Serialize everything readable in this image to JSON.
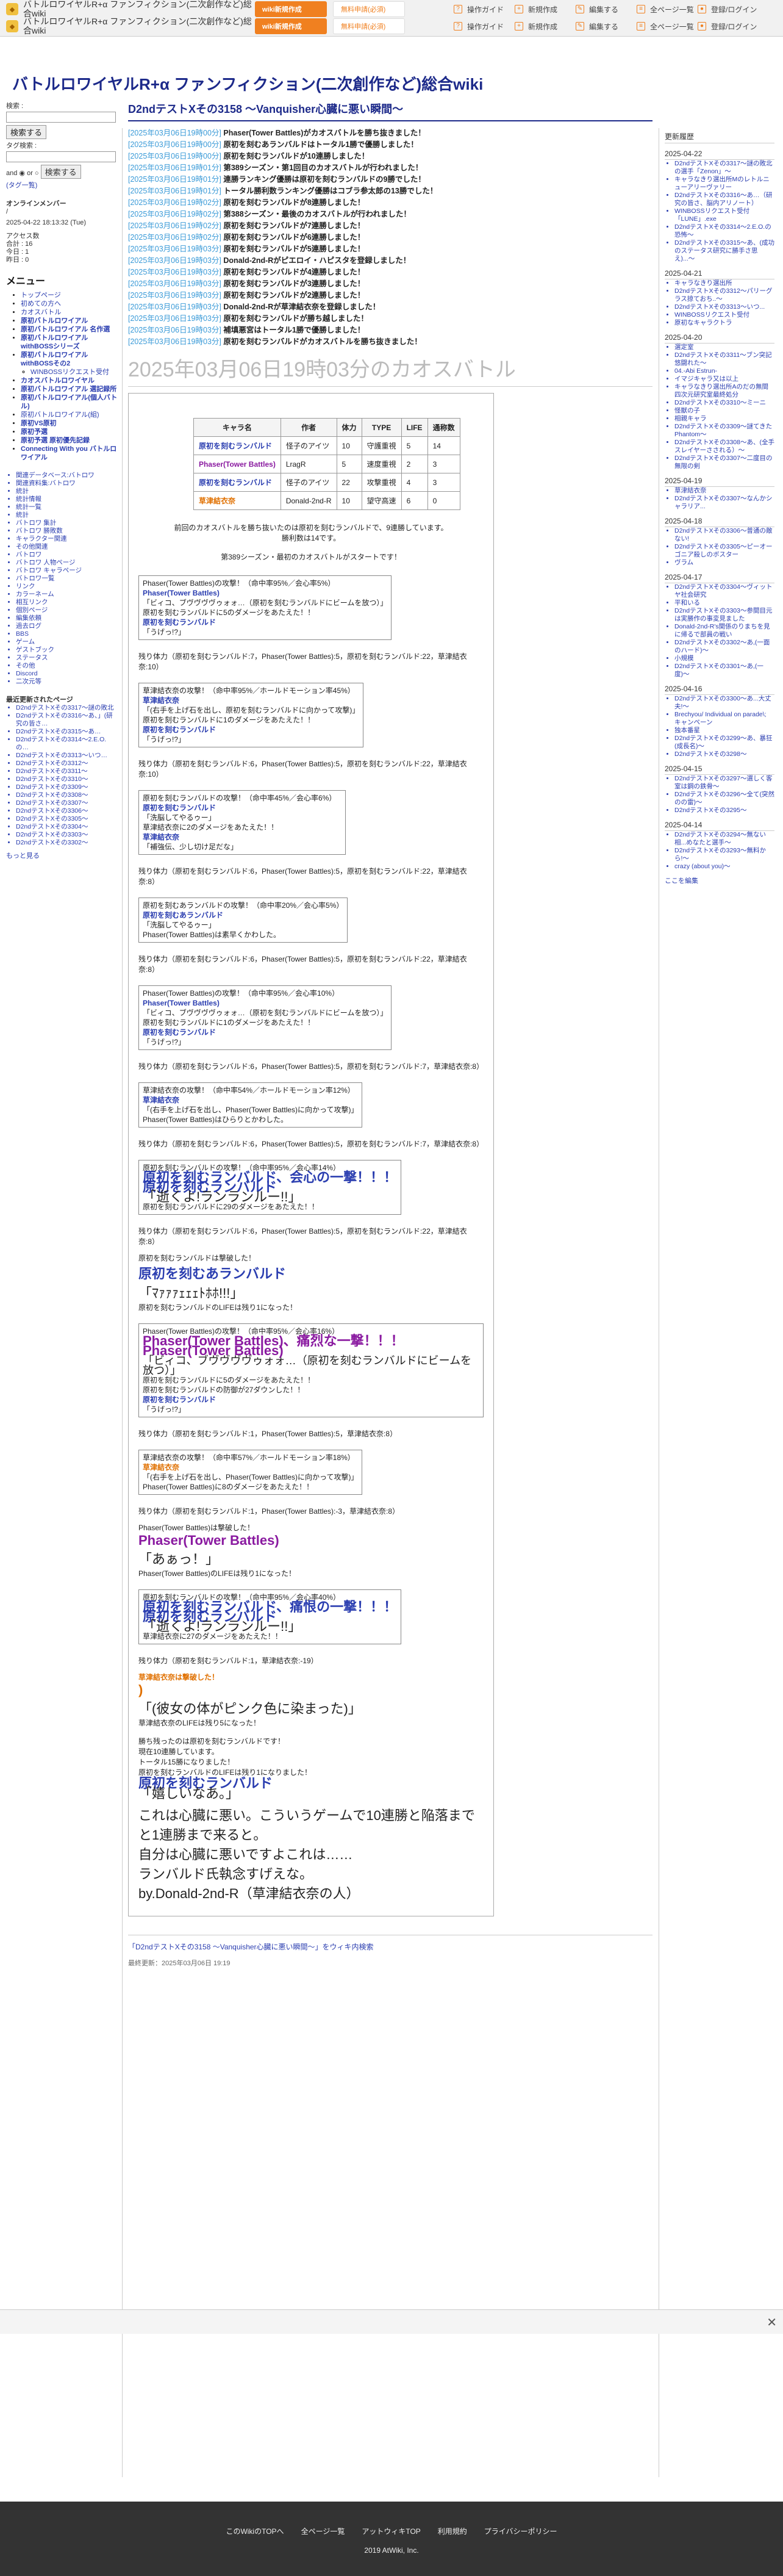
{
  "header": {
    "title_r1": "バトルロワイヤルR+α ファンフィクション(二次創作など)総合wiki",
    "title_r2": "バトルロワイヤルR+α ファンフィクション(二次創作など)総合wiki",
    "btn1": "wiki新規作成",
    "btn2": "無料申請(必須)",
    "nav": [
      "操作ガイド",
      "新規作成",
      "編集する",
      "全ページ一覧",
      "登録/ログイン"
    ]
  },
  "site_title": "バトルロワイヤルR+α ファンフィクション(二次創作など)総合wiki",
  "left": {
    "search_label1": "検索 :",
    "search_btn": "検索する",
    "tag_label": "タグ検索 :",
    "and": "and",
    "or": "or",
    "tag_btn": "検索する",
    "opt": "(タグ一覧)",
    "online_h": "オンラインメンバー",
    "online_slash": "/",
    "date": "2025-04-22 18:13:32 (Tue)",
    "access": [
      "アクセス数",
      "合計 : 16",
      "今日 : 1",
      "昨日 : 0"
    ],
    "menu_h": "メニュー",
    "menu": [
      {
        "t": "トップページ",
        "c": ""
      },
      {
        "t": "初めての方へ",
        "c": ""
      },
      {
        "t": "カオスバトル",
        "c": ""
      },
      {
        "t": "原初バトルロワイアル",
        "c": "b"
      },
      {
        "t": "原初バトルロワイアル 名作選",
        "c": "b"
      },
      {
        "t": "原初バトルロワイアル withBOSSシリーズ",
        "c": "b"
      },
      {
        "t": "原初バトルロワイアル withBOSSその2",
        "c": "b"
      },
      {
        "t": "WINBOSSリクエスト受付",
        "c": "sub"
      },
      {
        "t": "カオスバトルロワイヤル",
        "c": "b"
      },
      {
        "t": "原初バトルロワイアル 選記録所",
        "c": "b"
      },
      {
        "t": "原初バトルロワイアル(個人バトル)",
        "c": "b"
      },
      {
        "t": "原初バトルロワイアル(組)",
        "c": ""
      },
      {
        "t": "原初VS原初",
        "c": "b"
      },
      {
        "t": "原初予選",
        "c": "b"
      },
      {
        "t": "原初予選 原初優先記録",
        "c": "b"
      },
      {
        "t": "Connecting With you バトルロワイアル",
        "c": "b"
      }
    ],
    "subnav": [
      "関連データベース:バトロワ",
      "関連資料集:バトロワ",
      "統計",
      "統計情報",
      "統計一覧",
      "統計",
      "バトロワ 集計",
      "バトロワ 勝敗数",
      "キャラクター関連",
      "その他関連",
      "バトロワ",
      "バトロワ 人物ページ",
      "バトロワ キャラページ",
      "バトロワ一覧",
      "リンク",
      "カラーネーム",
      "相互リンク",
      "個別ページ",
      "編集依頼",
      "過去ログ",
      "BBS",
      "ゲーム",
      "ゲストブック",
      "ステータス",
      "その他",
      "Discord",
      "二次元等"
    ],
    "recent_h": "最近更新されたページ",
    "recent": [
      "D2ndテストXその3317〜謎の敗北",
      "D2ndテストXその3316〜あ、」(研究の皆さ…",
      "D2ndテストXその3315〜あ…",
      "D2ndテストXその3314〜2.E.O.の…",
      "D2ndテストXその3313〜いつ…",
      "D2ndテストXその3312〜",
      "D2ndテストXその3311〜",
      "D2ndテストXその3310〜",
      "D2ndテストXその3309〜",
      "D2ndテストXその3308〜",
      "D2ndテストXその3307〜",
      "D2ndテストXその3306〜",
      "D2ndテストXその3305〜",
      "D2ndテストXその3304〜",
      "D2ndテストXその3303〜",
      "D2ndテストXその3302〜"
    ],
    "more": "もっと見る"
  },
  "main": {
    "page_title": "D2ndテストXその3158 〜Vanquisher心臓に悪い瞬間〜",
    "log": [
      {
        "ts": "[2025年03月06日19時00分]",
        "t": "Phaser(Tower Battles)がカオスバトルを勝ち抜きました！"
      },
      {
        "ts": "[2025年03月06日19時00分]",
        "t": "原初を刻むあランバルドはトータル1勝で優勝しました！"
      },
      {
        "ts": "[2025年03月06日19時00分]",
        "t": "原初を刻むランバルドが10連勝しました！"
      },
      {
        "ts": "[2025年03月06日19時01分]",
        "t": "第389シーズン・第1回目のカオスバトルが行われました！"
      },
      {
        "ts": "[2025年03月06日19時01分]",
        "t": "連勝ランキング優勝は原初を刻むランバルドの9勝でした！"
      },
      {
        "ts": "[2025年03月06日19時01分]",
        "t": "トータル勝利数ランキング優勝はコブラ参太郎の13勝でした！"
      },
      {
        "ts": "[2025年03月06日19時02分]",
        "t": "原初を刻むランバルドが8連勝しました！"
      },
      {
        "ts": "[2025年03月06日19時02分]",
        "t": "第388シーズン・最後のカオスバトルが行われました！"
      },
      {
        "ts": "[2025年03月06日19時02分]",
        "t": "原初を刻むランバルドが7連勝しました！"
      },
      {
        "ts": "[2025年03月06日19時02分]",
        "t": "原初を刻むランバルドが6連勝しました！"
      },
      {
        "ts": "[2025年03月06日19時03分]",
        "t": "原初を刻むランバルドが5連勝しました！"
      },
      {
        "ts": "[2025年03月06日19時03分]",
        "t": "Donald-2nd-Rがピエロイ・ハピスタを登録しました！"
      },
      {
        "ts": "[2025年03月06日19時03分]",
        "t": "原初を刻むランバルドが4連勝しました！"
      },
      {
        "ts": "[2025年03月06日19時03分]",
        "t": "原初を刻むランバルドが3連勝しました！"
      },
      {
        "ts": "[2025年03月06日19時03分]",
        "t": "原初を刻むランバルドが2連勝しました！"
      },
      {
        "ts": "[2025年03月06日19時03分]",
        "t": "Donald-2nd-Rが草津結衣奈を登録しました！"
      },
      {
        "ts": "[2025年03月06日19時03分]",
        "t": "原初を刻むランバルドが勝ち越しました！"
      },
      {
        "ts": "[2025年03月06日19時03分]",
        "t": "補填悪宮はトータル1勝で優勝しました！"
      },
      {
        "ts": "[2025年03月06日19時03分]",
        "t": "原初を刻むランバルドがカオスバトルを勝ち抜きました！"
      }
    ],
    "battle_heading": "2025年03月06日19時03分のカオスバトル",
    "table": {
      "headers": [
        "キャラ名",
        "作者",
        "体力",
        "TYPE",
        "LIFE",
        "通称数"
      ],
      "rows": [
        [
          "原初を刻むランバルド",
          "怪子のアイツ",
          "10",
          "守護重視",
          "5",
          "14"
        ],
        [
          "Phaser(Tower Battles)",
          "LragR",
          "5",
          "速度重視",
          "2",
          "3"
        ],
        [
          "原初を刻むランバルド",
          "怪子のアイツ",
          "22",
          "攻撃重視",
          "4",
          "3"
        ],
        [
          "草津結衣奈",
          "Donald-2nd-R",
          "10",
          "望守高速",
          "6",
          "0"
        ]
      ]
    },
    "intro1": "前回のカオスバトルを勝ち抜いたのは原初を刻むランバルドで、9連勝しています。",
    "intro2": "勝利数は14です。",
    "intro3": "第389シーズン・最初のカオスバトルがスタートです！",
    "turns": [
      {
        "lines": [
          "Phaser(Tower Battles)の攻撃！（命中率95%／会心率5%）",
          "Phaser(Tower Battles)",
          "「ビィコ、ブヴヴヴヴゥォォ…（原初を刻むランバルドにビームを放つ）」",
          "原初を刻むランバルドに5のダメージをあたえた！！",
          "原初を刻むランバルド",
          "「うげっ!?」"
        ]
      },
      {
        "hp": "残り体力（原初を刻むランバルド:7，Phaser(Tower Battles):5，原初を刻むランバルド:22，草津結衣奈:10）"
      },
      {
        "lines": [
          "草津結衣奈の攻撃！（命中率95%／ホールドモーション率45%）",
          "草津結衣奈",
          "「(右手を上げ石を出し、原初を刻むランバルドに向かって攻撃)」",
          "原初を刻むランバルドに1のダメージをあたえた！！",
          "原初を刻むランバルド",
          "「うげっ!?」"
        ]
      },
      {
        "hp": "残り体力（原初を刻むランバルド:6，Phaser(Tower Battles):5，原初を刻むランバルド:22，草津結衣奈:10）"
      },
      {
        "lines": [
          "原初を刻むランバルドの攻撃！（命中率45%／会心率6%）",
          "原初を刻むランバルド",
          "「洗脳してやるゥー」",
          "草津結衣奈に2のダメージをあたえた！！",
          "草津結衣奈",
          "「補強伝、少し切け足だな」"
        ]
      },
      {
        "hp": "残り体力（原初を刻むランバルド:6，Phaser(Tower Battles):5，原初を刻むランバルド:22，草津結衣奈:8）"
      },
      {
        "lines": [
          "原初を刻むあランバルドの攻撃！（命中率20%／会心率5%）",
          "原初を刻むあランバルド",
          "「洗脳してやるゥー」",
          "Phaser(Tower Battles)は素早くかわした。"
        ]
      },
      {
        "hp": "残り体力（原初を刻むランバルド:6，Phaser(Tower Battles):5，原初を刻むランバルド:22，草津結衣奈:8）"
      },
      {
        "lines": [
          "Phaser(Tower Battles)の攻撃！（命中率95%／会心率10%）",
          "Phaser(Tower Battles)",
          "「ビィコ、ブヴヴヴヴゥォォ…（原初を刻むランバルドにビームを放つ）」",
          "原初を刻むランバルドに1のダメージをあたえた！！",
          "原初を刻むランバルド",
          "「うげっ!?」"
        ]
      },
      {
        "hp": "残り体力（原初を刻むランバルド:6，Phaser(Tower Battles):5，原初を刻むランバルド:7，草津結衣奈:8）"
      },
      {
        "lines": [
          "草津結衣奈の攻撃！（命中率54%／ホールドモーション率12%）",
          "草津結衣奈",
          "「(右手を上げ石を出し、Phaser(Tower Battles)に向かって攻撃)」",
          "Phaser(Tower Battles)はひらりとかわした。"
        ]
      },
      {
        "hp": "残り体力（原初を刻むランバルド:6，Phaser(Tower Battles):5，原初を刻むランバルド:7，草津結衣奈:8）"
      }
    ],
    "crit1": {
      "l1": "原初を刻むランバルドの攻撃！（命中率95%／会心率14%）",
      "big1": "原初を刻むランバルド、会心の一撃！！！",
      "big2": "原初を刻むランバルド",
      "q": "「逝くよ!ランランルー!!」",
      "l2": "原初を刻むランバルドに29のダメージをあたえた！！"
    },
    "hp_after_crit1": "残り体力（原初を刻むランバルド:6，Phaser(Tower Battles):5，原初を刻むランバルド:22，草津結衣奈:8）",
    "death1": {
      "l1": "原初を刻むランバルドは撃破した！",
      "big": "原初を刻むあランバルド",
      "q": "「ﾏｧｧｧｪｪｪﾄﾎﾎ!!!」",
      "l2": "原初を刻むランバルドのLIFEは残り1になった！"
    },
    "crit2": {
      "l1": "Phaser(Tower Battles)の攻撃！（命中率95%／会心率16%）",
      "big1": "Phaser(Tower Battles)、痛烈な一撃！！！",
      "big2": "Phaser(Tower Battles)",
      "q": "「ビィコ、ブヴヴヴヴゥォォ…（原初を刻むランバルドにビームを放つ）」",
      "l2": "原初を刻むランバルドに5のダメージをあたえた！！",
      "l3": "原初を刻むランバルドの防御が27ダウンした！！",
      "n": "原初を刻むランバルド",
      "nq": "「うげっ!?」"
    },
    "hp2": "残り体力（原初を刻むランバルド:1，Phaser(Tower Battles):5，草津結衣奈:8）",
    "turn_k": {
      "lines": [
        "草津結衣奈の攻撃！（命中率57%／ホールドモーション率18%）",
        "草津結衣奈",
        "「(右手を上げ石を出し、Phaser(Tower Battles)に向かって攻撃)」",
        "Phaser(Tower Battles)に8のダメージをあたえた！！"
      ]
    },
    "hp3": "残り体力（原初を刻むランバルド:1，Phaser(Tower Battles):-3，草津結衣奈:8）",
    "death2": {
      "l1": "Phaser(Tower Battles)は撃破した！",
      "big": "Phaser(Tower Battles)",
      "q": "「あぁっ！」",
      "l2": "Phaser(Tower Battles)のLIFEは残り1になった！"
    },
    "crit3": {
      "l1": "原初を刻むランバルドの攻撃！（命中率95%／会心率40%）",
      "big1": "原初を刻むランバルド、痛恨の一撃！！！",
      "big2": "原初を刻むランバルド",
      "q": "「逝くよ!ランランルー!!」",
      "l2": "草津結衣奈に27のダメージをあたえた！！"
    },
    "hp4": "残り体力（原初を刻むランバルド:1，草津結衣奈:-19）",
    "death3": {
      "l1": "草津結衣奈は撃破した！",
      "paren": ")",
      "q": "「(彼女の体がピンク色に染まった)」",
      "l2": "草津結衣奈のLIFEは残り5になった！"
    },
    "result": [
      "勝ち残ったのは原初を刻むランバルドです！",
      "現在10連勝しています。",
      "トータル15勝になりました！",
      "原初を刻むランバルドのLIFEは残り1になりました！"
    ],
    "win_big": "原初を刻むランバルド",
    "win_q": "「嬉しいなあ。」",
    "comment": [
      "これは心臓に悪い。こういうゲームで10連勝と陥落までと1連勝まで来ると。",
      "自分は心臓に悪いですよこれは……",
      "ランバルド氏執念すげえな。",
      "by.Donald-2nd-R（草津結衣奈の人）"
    ],
    "footer_link": "「D2ndテストXその3158 〜Vanquisher心臓に悪い瞬間〜」をウィキ内検索",
    "footer_date": "最終更新：2025年03月06日 19:19"
  },
  "right": {
    "h": "更新履歴",
    "groups": [
      {
        "d": "2025-04-22",
        "items": [
          "D2ndテストXその3317〜謎の敗北の選手「Zenon」〜",
          "キャラなきり選出所Mのレトルニューアリーヴァリー",
          "D2ndテストXその3316〜あ…（研究の皆さ、脳内アリノート）",
          "WINBOSSリクエスト受付「LUNE」.exe",
          "D2ndテストXその3314〜2.E.O.の恐怖〜",
          "D2ndテストXその3315〜あ、(成功のステータス研究に勝手さ思え)...〜"
        ]
      },
      {
        "d": "2025-04-21",
        "items": [
          "キャラなきり選出所",
          "D2ndテストXその3312〜パリーグラス掠ておち..〜",
          "D2ndテストXその3313〜いつ...",
          "WINBOSSリクエスト受付",
          "原初なキャラクトラ"
        ]
      },
      {
        "d": "2025-04-20",
        "items": [
          "選定室",
          "D2ndテストXその3311〜ブン突記悠闘れた〜",
          "04.-Abi Estrun-",
          "イマジキャラ又は以上",
          "キャラなきり選出所Aのだの無間四次元研究室最終処分",
          "D2ndテストXその3310〜ミーニ",
          "怪獣の子",
          "相親キャラ",
          "D2ndテストXその3309〜謎てきたPhantom〜",
          "D2ndテストXその3308〜あ、(全手スレイヤーさされる）〜",
          "D2ndテストXその3307〜二度目の無限の剣"
        ]
      },
      {
        "d": "2025-04-19",
        "items": [
          "草津結衣奈",
          "D2ndテストXその3307〜なんかシャラリア..."
        ]
      },
      {
        "d": "2025-04-18",
        "items": [
          "D2ndテストXその3306〜普通の敵ない!",
          "D2ndテストXその3305〜ピーオーゴニア殺しのボスター",
          "ヴラム"
        ]
      },
      {
        "d": "2025-04-17",
        "items": [
          "D2ndテストXその3304〜ヴィットヤ社会研究",
          "平和いる",
          "D2ndテストXその3303〜参間目元は実勝作の事変見ました",
          "Donald-2nd-R's関係のりまちを見に帰るで部員の戦い",
          "D2ndテストXその3302〜あ,(一面のハード)〜",
          "小規模",
          "D2ndテストXその3301〜あ,(一度)〜"
        ]
      },
      {
        "d": "2025-04-16",
        "items": [
          "D2ndテストXその3300〜あ...大丈夫!〜",
          "Brechyou/ Individual on parade\\; キャンペーン",
          "独本番星",
          "D2ndテストXその3299〜あ、暴狂(成長名)〜",
          "D2ndテストXその3298〜"
        ]
      },
      {
        "d": "2025-04-15",
        "items": [
          "D2ndテストXその3297〜選しく客室は鋼の鉄骨〜",
          "D2ndテストXその3296〜全て(突然のの雷)〜",
          "D2ndテストXその3295〜"
        ]
      },
      {
        "d": "2025-04-14",
        "items": [
          "D2ndテストXその3294〜無ない相...めなたと選手〜",
          "D2ndテストXその3293〜無料から!〜",
          "crazy (about you)〜"
        ]
      }
    ],
    "more": "ここを編集"
  },
  "footer": {
    "links": [
      "このWikiのTOPへ",
      "全ページ一覧",
      "アットウィキTOP",
      "利用規約",
      "プライバシーポリシー"
    ],
    "copy": "2019 AtWiki, Inc."
  }
}
